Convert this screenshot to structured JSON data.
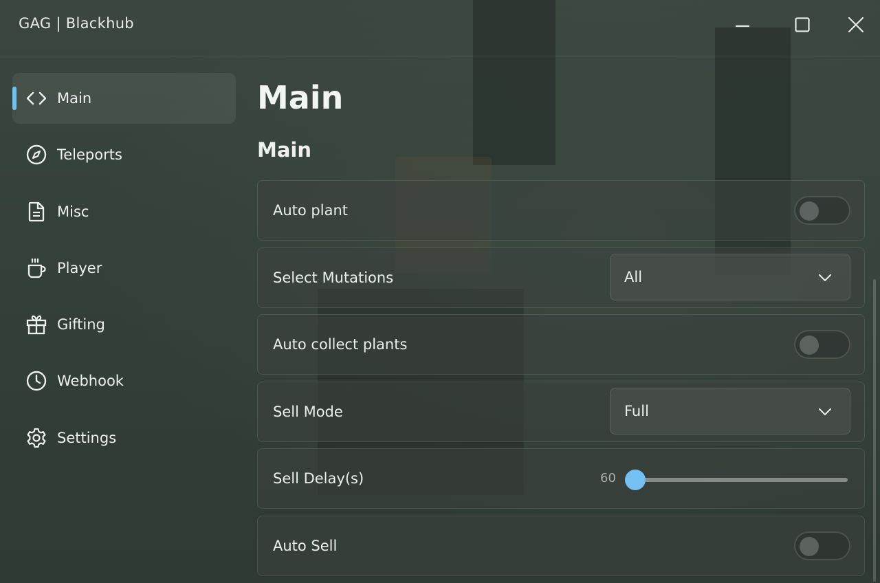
{
  "window": {
    "title": "GAG | Blackhub"
  },
  "sidebar": {
    "items": [
      {
        "label": "Main",
        "icon": "code-icon",
        "active": true
      },
      {
        "label": "Teleports",
        "icon": "compass-icon",
        "active": false
      },
      {
        "label": "Misc",
        "icon": "document-icon",
        "active": false
      },
      {
        "label": "Player",
        "icon": "coffee-cup-icon",
        "active": false
      },
      {
        "label": "Gifting",
        "icon": "gift-icon",
        "active": false
      },
      {
        "label": "Webhook",
        "icon": "clock-icon",
        "active": false
      },
      {
        "label": "Settings",
        "icon": "gear-icon",
        "active": false
      }
    ]
  },
  "main": {
    "page_title": "Main",
    "section_title": "Main",
    "rows": [
      {
        "label": "Auto plant",
        "type": "toggle",
        "on": false
      },
      {
        "label": "Select Mutations",
        "type": "dropdown",
        "value": "All"
      },
      {
        "label": "Auto collect plants",
        "type": "toggle",
        "on": false
      },
      {
        "label": "Sell Mode",
        "type": "dropdown",
        "value": "Full"
      },
      {
        "label": "Sell Delay(s)",
        "type": "slider",
        "value": "60",
        "fraction": 0.0
      },
      {
        "label": "Auto Sell",
        "type": "toggle",
        "on": false
      }
    ]
  },
  "colors": {
    "accent": "#6ec2f0",
    "background": "#36423b"
  }
}
